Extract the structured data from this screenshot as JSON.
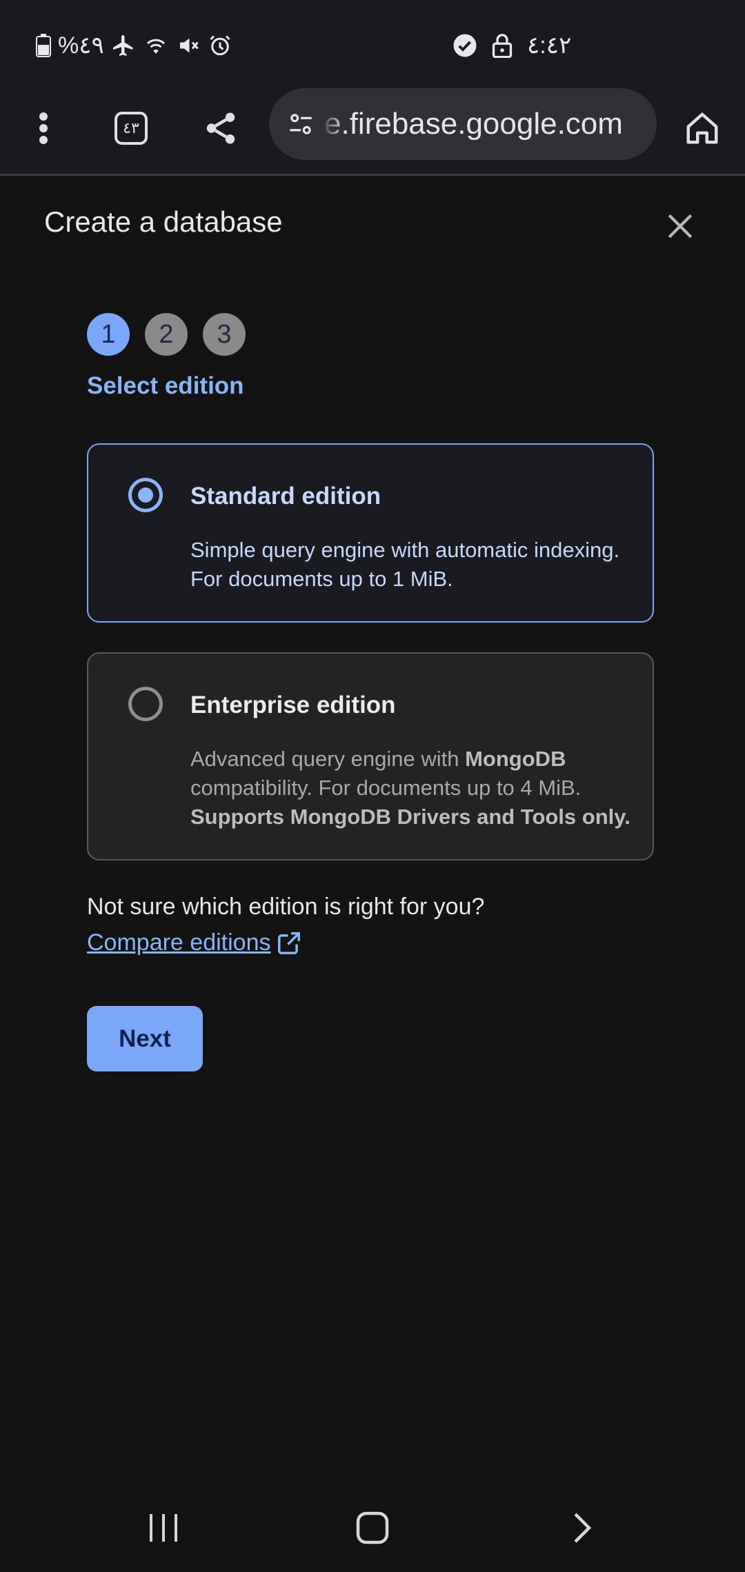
{
  "status_bar": {
    "battery_percent": "%٤٩",
    "time": "٤:٤٢"
  },
  "browser": {
    "tab_count": "٤٣",
    "url": "e.firebase.google.com"
  },
  "dialog": {
    "title": "Create a database",
    "steps": [
      "1",
      "2",
      "3"
    ],
    "active_step": 1,
    "step_label": "Select edition",
    "options": [
      {
        "title": "Standard edition",
        "description": "Simple query engine with automatic indexing. For documents up to 1 MiB.",
        "selected": true
      },
      {
        "title": "Enterprise edition",
        "description_parts": [
          "Advanced query engine with ",
          "MongoDB",
          " compatibility. For documents up to 4 MiB. ",
          "Supports MongoDB Drivers and Tools only."
        ],
        "selected": false
      }
    ],
    "help_text": "Not sure which edition is right for you?",
    "compare_link": "Compare editions",
    "next_label": "Next"
  },
  "colors": {
    "accent": "#7aa7f7",
    "background": "#131313"
  }
}
